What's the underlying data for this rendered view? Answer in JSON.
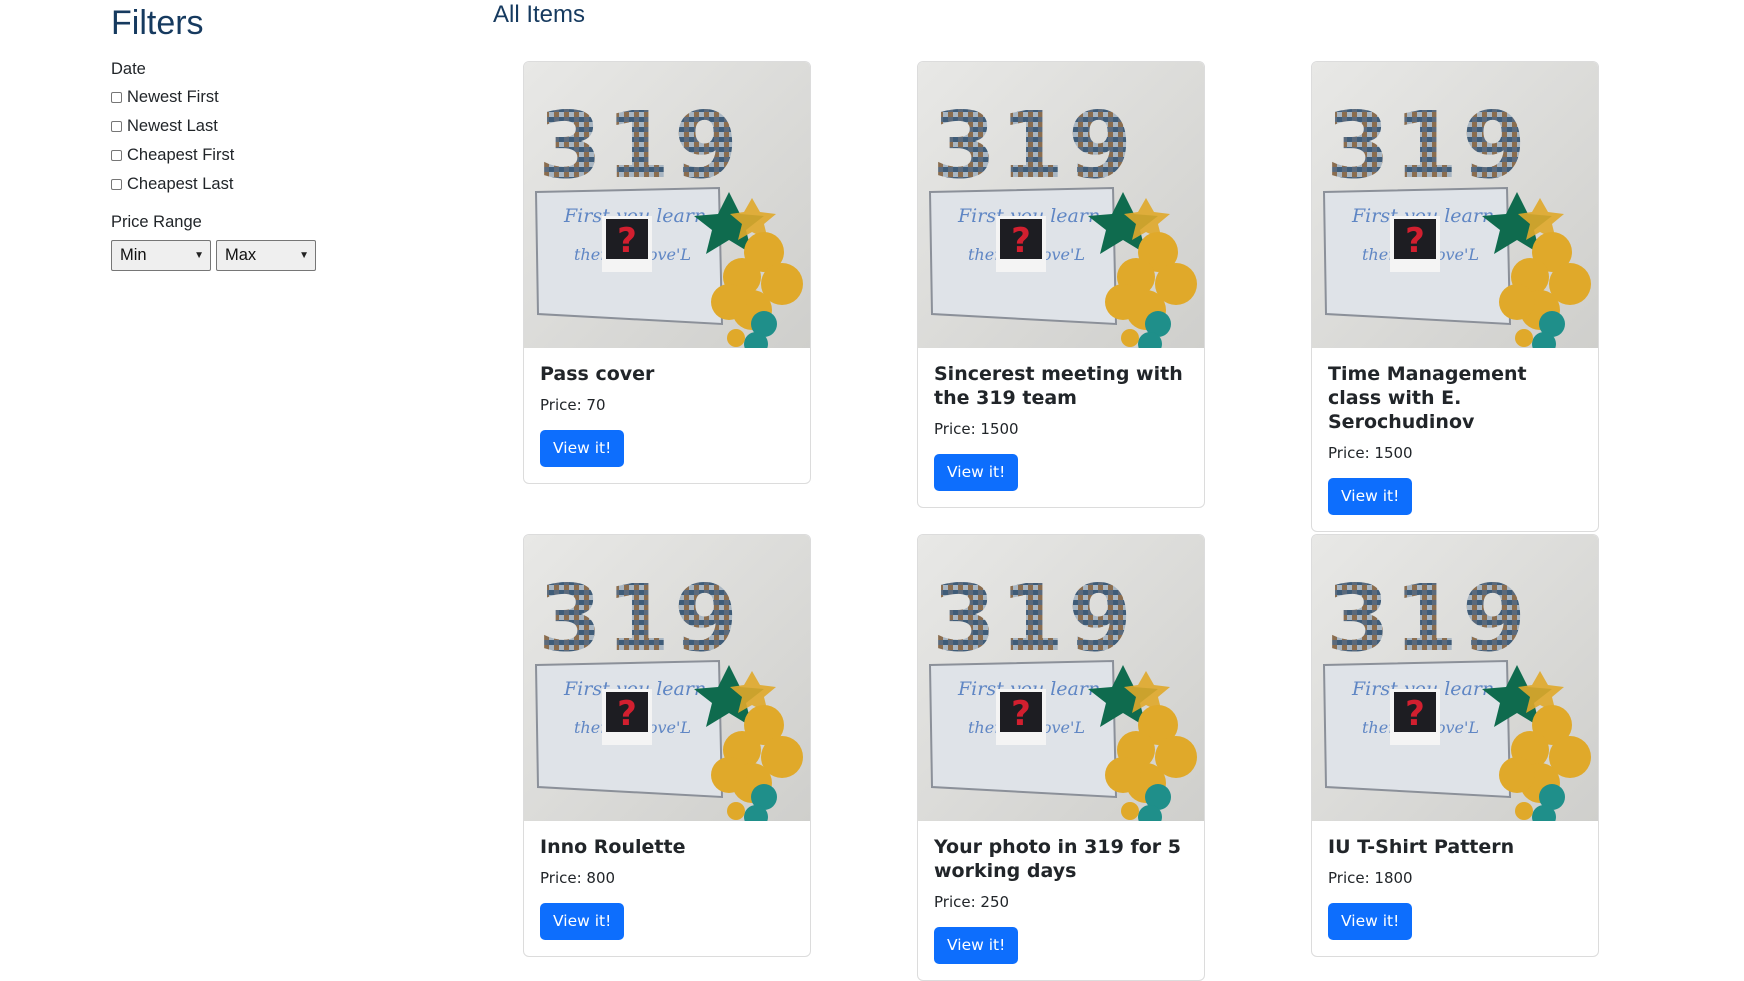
{
  "sidebar": {
    "title": "Filters",
    "date_label": "Date",
    "date_options": [
      "Newest First",
      "Newest Last",
      "Cheapest First",
      "Cheapest Last"
    ],
    "price_label": "Price Range",
    "min_select": "Min",
    "max_select": "Max"
  },
  "main": {
    "title": "All Items",
    "items": [
      {
        "title": "Pass cover",
        "price": "Price: 70",
        "button": "View it!"
      },
      {
        "title": "Sincerest meeting with the 319 team",
        "price": "Price: 1500",
        "button": "View it!"
      },
      {
        "title": "Time Management class with E. Serochudinov",
        "price": "Price: 1500",
        "button": "View it!"
      },
      {
        "title": "Inno Roulette",
        "price": "Price: 800",
        "button": "View it!"
      },
      {
        "title": "Your photo in 319 for 5 working days",
        "price": "Price: 250",
        "button": "View it!"
      },
      {
        "title": "IU T-Shirt Pattern",
        "price": "Price: 1800",
        "button": "View it!"
      }
    ],
    "image_text": {
      "number": "319",
      "line1": "First you learn",
      "line2": "then remove'L",
      "mark": "?"
    }
  },
  "colors": {
    "heading": "#163a5f",
    "button": "#0d6efd",
    "balloon_gold": "#e0a92a",
    "balloon_teal": "#1f8f8a",
    "star_green": "#0f6b4e"
  }
}
